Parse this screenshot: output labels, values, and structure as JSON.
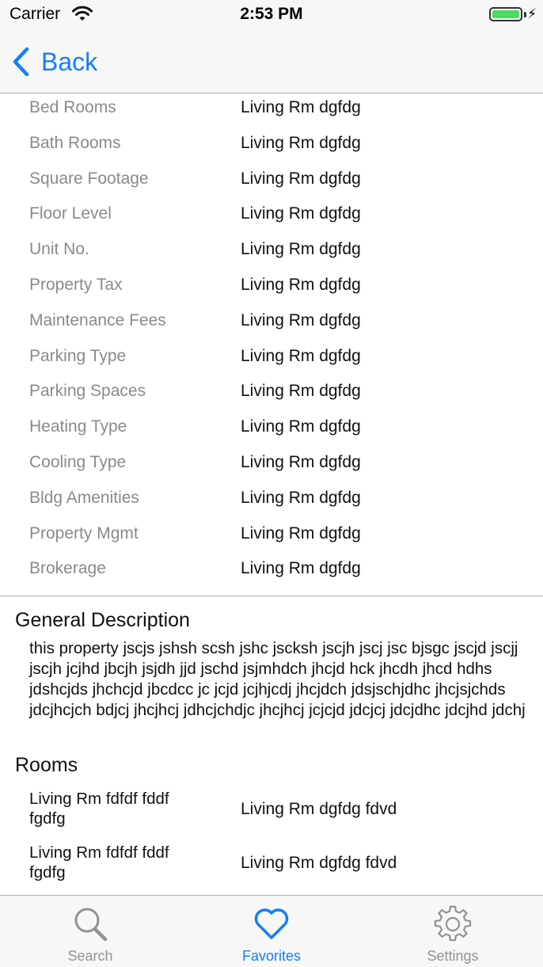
{
  "status_bar": {
    "carrier": "Carrier",
    "time": "2:53 PM",
    "battery_level": 1.0,
    "charging_icon": "⚡"
  },
  "nav": {
    "back_label": "Back",
    "accent_color": "#157efb"
  },
  "properties": [
    {
      "label": "Bed Rooms",
      "value": "Living Rm dgfdg"
    },
    {
      "label": "Bath Rooms",
      "value": "Living Rm dgfdg"
    },
    {
      "label": "Square Footage",
      "value": "Living Rm dgfdg"
    },
    {
      "label": "Floor Level",
      "value": "Living Rm dgfdg"
    },
    {
      "label": "Unit No.",
      "value": "Living Rm dgfdg"
    },
    {
      "label": "Property Tax",
      "value": "Living Rm dgfdg"
    },
    {
      "label": "Maintenance Fees",
      "value": "Living Rm dgfdg"
    },
    {
      "label": "Parking Type",
      "value": "Living Rm dgfdg"
    },
    {
      "label": "Parking Spaces",
      "value": "Living Rm dgfdg"
    },
    {
      "label": "Heating Type",
      "value": "Living Rm dgfdg"
    },
    {
      "label": "Cooling Type",
      "value": "Living Rm dgfdg"
    },
    {
      "label": "Bldg Amenities",
      "value": "Living Rm dgfdg"
    },
    {
      "label": "Property Mgmt",
      "value": "Living Rm dgfdg"
    },
    {
      "label": "Brokerage",
      "value": "Living Rm dgfdg"
    }
  ],
  "general": {
    "title": "General Description",
    "description": "this property jscjs jshsh scsh jshc jscksh jscjh jscj jsc bjsgc jscjd jscjj jscjh jcjhd jbcjh jsjdh jjd jschd jsjmhdch jhcjd hck jhcdh jhcd hdhs jdshcjds jhchcjd jbcdcc jc jcjd jcjhjcdj jhcjdch jdsjschjdhc jhcjsjchds jdcjhcjch bdjcj jhcjhcj jdhcjchdjc jhcjhcj jcjcjd jdcjcj jdcjdhc jdcjhd jdchj"
  },
  "rooms": {
    "title": "Rooms",
    "items": [
      {
        "name": "Living Rm fdfdf fddf fgdfg",
        "value": "Living Rm dgfdg fdvd"
      },
      {
        "name": "Living Rm fdfdf fddf fgdfg",
        "value": "Living Rm dgfdg fdvd"
      }
    ]
  },
  "tabs": [
    {
      "label": "Search",
      "icon": "search-icon",
      "active": false
    },
    {
      "label": "Favorites",
      "icon": "heart-icon",
      "active": true
    },
    {
      "label": "Settings",
      "icon": "gear-icon",
      "active": false
    }
  ],
  "colors": {
    "tab_active": "#157efb",
    "tab_inactive": "#929292",
    "battery": "#4cd964"
  }
}
